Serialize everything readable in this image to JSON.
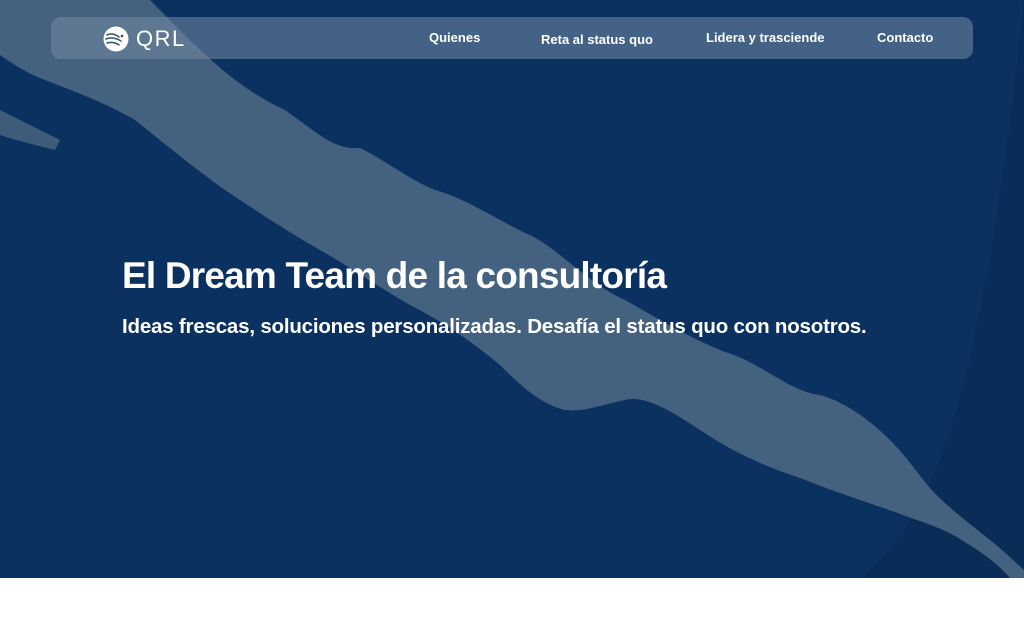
{
  "brand": {
    "logo_text": "QRL",
    "logo_icon": "lion-head-icon"
  },
  "nav": {
    "items": [
      {
        "label": "Quienes"
      },
      {
        "label": "Reta al status quo"
      },
      {
        "label": "Lidera y trasciende"
      },
      {
        "label": "Contacto"
      }
    ]
  },
  "hero": {
    "title": "El Dream Team de la consultoría",
    "subtitle": "Ideas frescas, soluciones personalizadas. Desafía el status quo con nosotros.",
    "background_icon": "brush-stroke-graphic"
  },
  "colors": {
    "hero_background": "#0b3160",
    "brush_stroke": "#44627f",
    "navbar": "#748ba6",
    "text": "#ffffff",
    "page_background": "#ffffff"
  }
}
